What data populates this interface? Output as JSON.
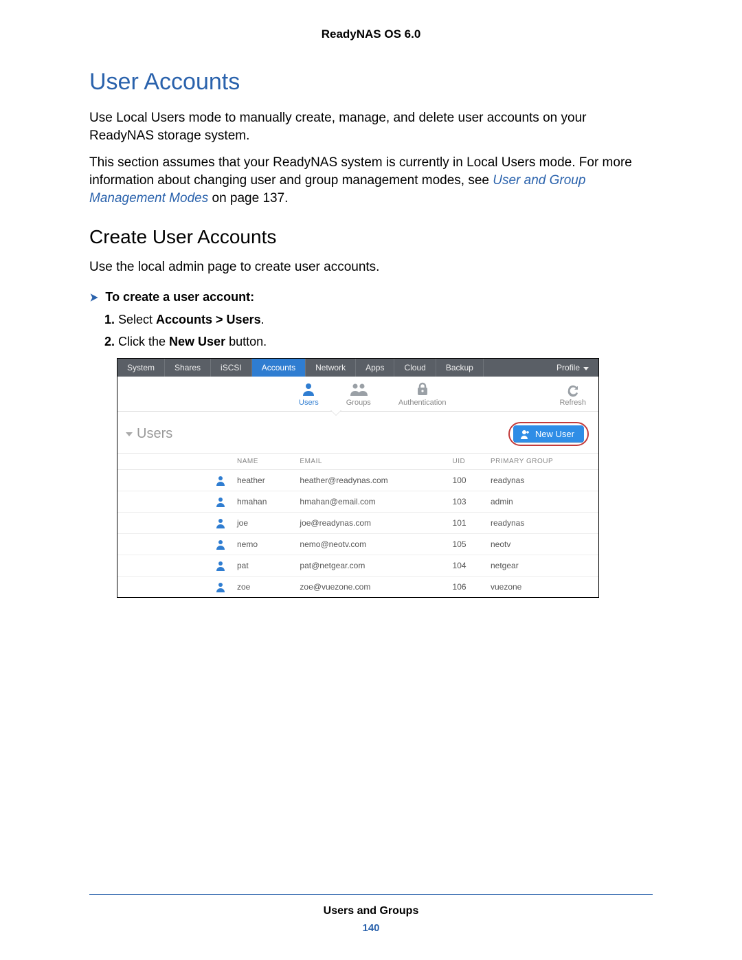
{
  "doc_header": "ReadyNAS OS 6.0",
  "h1": "User Accounts",
  "p1": "Use Local Users mode to manually create, manage, and delete user accounts on your ReadyNAS storage system.",
  "p2_a": "This section assumes that your ReadyNAS system is currently in Local Users mode. For more information about changing user and group management modes, see ",
  "p2_link": "User and Group Management Modes",
  "p2_b": " on page 137.",
  "h2": "Create User Accounts",
  "p3": "Use the local admin page to create user accounts.",
  "proc_title": "To create a user account:",
  "step1_a": "Select ",
  "step1_b": "Accounts > Users",
  "step1_c": ".",
  "step2_a": "Click the ",
  "step2_b": "New User",
  "step2_c": " button.",
  "app": {
    "tabs": [
      "System",
      "Shares",
      "iSCSI",
      "Accounts",
      "Network",
      "Apps",
      "Cloud",
      "Backup"
    ],
    "active_tab_index": 3,
    "profile_label": "Profile",
    "subnav": {
      "users": "Users",
      "groups": "Groups",
      "auth": "Authentication",
      "refresh": "Refresh"
    },
    "panel_title": "Users",
    "new_user_label": "New User",
    "columns": {
      "name": "NAME",
      "email": "EMAIL",
      "uid": "UID",
      "group": "PRIMARY GROUP"
    },
    "rows": [
      {
        "name": "heather",
        "email": "heather@readynas.com",
        "uid": "100",
        "group": "readynas"
      },
      {
        "name": "hmahan",
        "email": "hmahan@email.com",
        "uid": "103",
        "group": "admin"
      },
      {
        "name": "joe",
        "email": "joe@readynas.com",
        "uid": "101",
        "group": "readynas"
      },
      {
        "name": "nemo",
        "email": "nemo@neotv.com",
        "uid": "105",
        "group": "neotv"
      },
      {
        "name": "pat",
        "email": "pat@netgear.com",
        "uid": "104",
        "group": "netgear"
      },
      {
        "name": "zoe",
        "email": "zoe@vuezone.com",
        "uid": "106",
        "group": "vuezone"
      }
    ]
  },
  "footer_label": "Users and Groups",
  "footer_page": "140"
}
